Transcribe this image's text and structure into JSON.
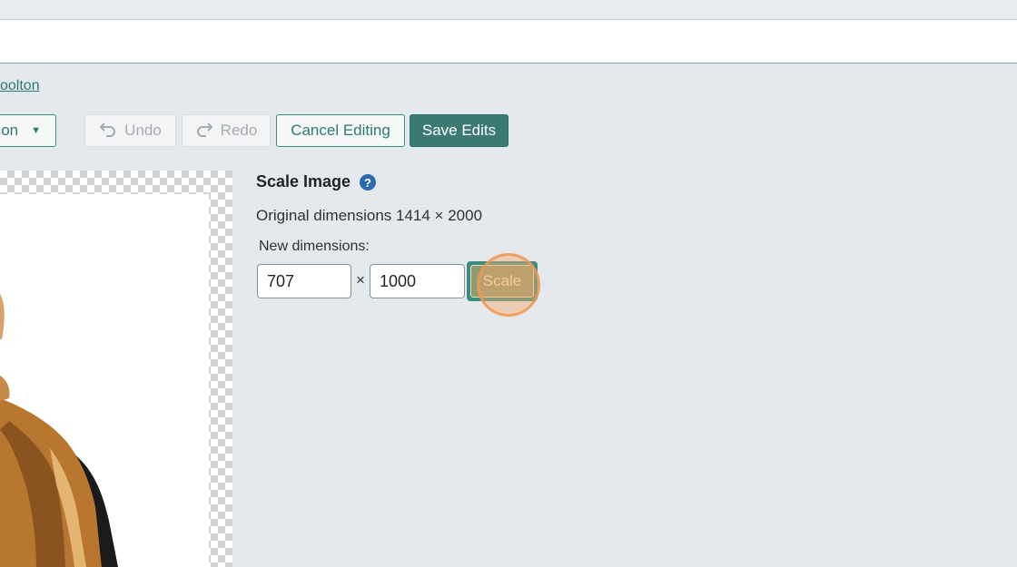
{
  "header": {
    "author_link": "oolton"
  },
  "toolbar": {
    "action_select_label": "ion",
    "undo_label": "Undo",
    "redo_label": "Redo",
    "cancel_label": "Cancel Editing",
    "save_label": "Save Edits"
  },
  "scale_panel": {
    "title": "Scale Image",
    "help_icon_text": "?",
    "original_dimensions": "Original dimensions 1414 × 2000",
    "new_dimensions_label": "New dimensions:",
    "width_value": "707",
    "height_value": "1000",
    "times_sign": "×",
    "scale_button_label": "Scale"
  },
  "colors": {
    "accent": "#3a8c84",
    "save_button": "#3b7a72",
    "help_icon": "#2a6bb0",
    "click_marker": "#f5aa6e"
  }
}
